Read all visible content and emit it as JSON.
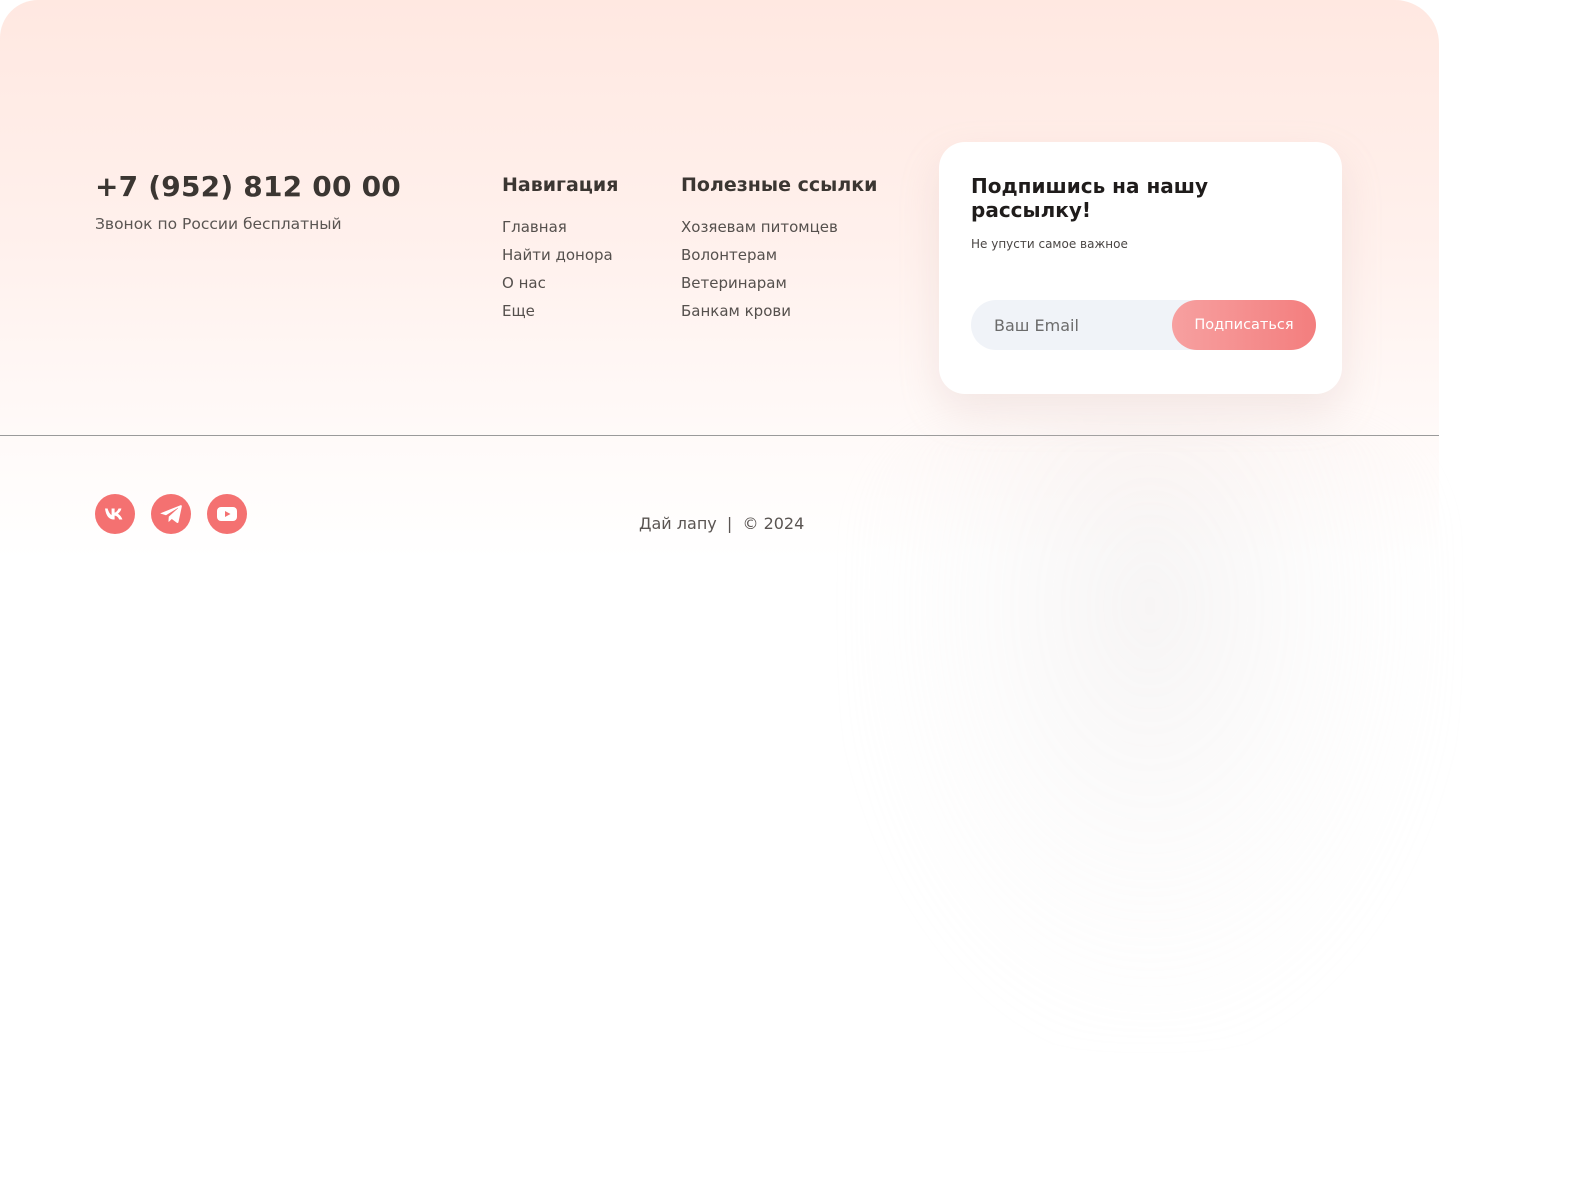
{
  "contact": {
    "phone": "+7 (952) 812 00 00",
    "phone_note": "Звонок по России бесплатный"
  },
  "navigation": {
    "title": "Навигация",
    "items": [
      "Главная",
      "Найти донора",
      "О нас",
      "Еще"
    ]
  },
  "useful_links": {
    "title": "Полезные ссылки",
    "items": [
      "Хозяевам питомцев",
      "Волонтерам",
      "Ветеринарам",
      "Банкам крови"
    ]
  },
  "subscribe": {
    "title": "Подпишись на нашу рассылку!",
    "subtitle": "Не упусти самое важное",
    "email_placeholder": "Ваш Email",
    "email_value": "",
    "button_label": "Подписаться"
  },
  "socials": [
    {
      "name": "vk-icon"
    },
    {
      "name": "telegram-icon"
    },
    {
      "name": "youtube-icon"
    }
  ],
  "footer_bottom": {
    "copyright": "Дай лапу  |  © 2024"
  },
  "colors": {
    "accent": "#f47171",
    "button_gradient_start": "#f7a0a0",
    "button_gradient_end": "#f37e7e",
    "background_top": "#ffe8e1",
    "input_background": "#f0f3f8"
  }
}
